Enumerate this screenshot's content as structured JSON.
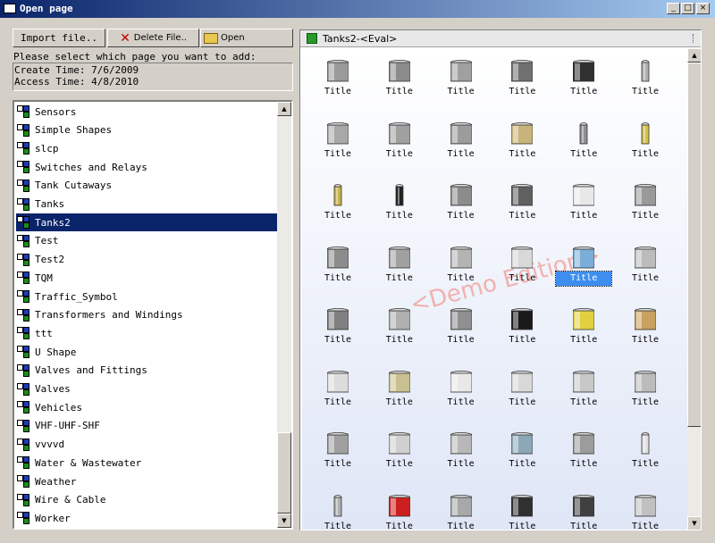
{
  "window": {
    "title": "Open page",
    "controls": [
      "_",
      "□",
      "×"
    ]
  },
  "toolbar": {
    "import_label": "Import file..",
    "delete_label": "Delete File..",
    "open_label": "Open"
  },
  "prompt": "Please select which page you want to add:",
  "info": {
    "create": "Create Time: 7/6/2009",
    "access": "Access Time: 4/8/2010"
  },
  "pages": [
    "Sensors",
    "Simple Shapes",
    "slcp",
    "Switches and Relays",
    "Tank Cutaways",
    "Tanks",
    "Tanks2",
    "Test",
    "Test2",
    "TQM",
    "Traffic_Symbol",
    "Transformers and Windings",
    "ttt",
    "U Shape",
    "Valves and Fittings",
    "Valves",
    "Vehicles",
    "VHF-UHF-SHF",
    "vvvvd",
    "Water & Wastewater",
    "Weather",
    "Wire & Cable",
    "Worker"
  ],
  "selected_page": "Tanks2",
  "preview": {
    "title": "Tanks2-<Eval>",
    "watermark": "<Demo Edition>",
    "selected_index": 22,
    "items": [
      {
        "label": "Title",
        "icon": "flat-top-tank-icon",
        "color": "#9a9a9a"
      },
      {
        "label": "Title",
        "icon": "storage-tank-icon",
        "color": "#8c8c8c"
      },
      {
        "label": "Title",
        "icon": "ribbed-tank-icon",
        "color": "#a0a0a0"
      },
      {
        "label": "Title",
        "icon": "horizontal-grid-tank-icon",
        "color": "#707070"
      },
      {
        "label": "Title",
        "icon": "louvered-box-icon",
        "color": "#303030"
      },
      {
        "label": "Title",
        "icon": "slim-column-icon",
        "color": "#b0b0b0"
      },
      {
        "label": "Title",
        "icon": "column-tank-icon",
        "color": "#a8a8a8"
      },
      {
        "label": "Title",
        "icon": "banded-column-icon",
        "color": "#a0a0a0"
      },
      {
        "label": "Title",
        "icon": "silo-bank-icon",
        "color": "#9c9c9c"
      },
      {
        "label": "Title",
        "icon": "brick-tower-icon",
        "color": "#c8b47a"
      },
      {
        "label": "Title",
        "icon": "piped-column-icon",
        "color": "#909090"
      },
      {
        "label": "Title",
        "icon": "yellow-gauge-column-icon",
        "color": "#d4c04a"
      },
      {
        "label": "Title",
        "icon": "gauge-column-icon",
        "color": "#c8b44a"
      },
      {
        "label": "Title",
        "icon": "black-column-icon",
        "color": "#202020"
      },
      {
        "label": "Title",
        "icon": "drum-icon",
        "color": "#8c8c8c"
      },
      {
        "label": "Title",
        "icon": "dark-drum-icon",
        "color": "#606060"
      },
      {
        "label": "Title",
        "icon": "bucket-icon",
        "color": "#e8e8e8"
      },
      {
        "label": "Title",
        "icon": "metal-drum-icon",
        "color": "#9a9a9a"
      },
      {
        "label": "Title",
        "icon": "cylinder-tank-icon",
        "color": "#8c8c8c"
      },
      {
        "label": "Title",
        "icon": "narrow-tank-icon",
        "color": "#a0a0a0"
      },
      {
        "label": "Title",
        "icon": "horizontal-tank-icon",
        "color": "#b4b4b4"
      },
      {
        "label": "Title",
        "icon": "light-tank-icon",
        "color": "#d8d8d8"
      },
      {
        "label": "Title",
        "icon": "hopper-icon",
        "color": "#7aaed8"
      },
      {
        "label": "Title",
        "icon": "half-drum-icon",
        "color": "#bcbcbc"
      },
      {
        "label": "Title",
        "icon": "cage-tank-icon",
        "color": "#808080"
      },
      {
        "label": "Title",
        "icon": "sphere-tank-icon",
        "color": "#b0b0b0"
      },
      {
        "label": "Title",
        "icon": "legged-sphere-icon",
        "color": "#909090"
      },
      {
        "label": "Title",
        "icon": "black-cylinder-icon",
        "color": "#1a1a1a"
      },
      {
        "label": "Title",
        "icon": "yellow-machine-icon",
        "color": "#e0d040"
      },
      {
        "label": "Title",
        "icon": "coil-icon",
        "color": "#c8a060"
      },
      {
        "label": "Title",
        "icon": "dome-tank-icon",
        "color": "#dcdcdc"
      },
      {
        "label": "Title",
        "icon": "olive-tank-icon",
        "color": "#c8c090"
      },
      {
        "label": "Title",
        "icon": "white-tank-icon",
        "color": "#e8e8e8"
      },
      {
        "label": "Title",
        "icon": "trough-icon",
        "color": "#d8d8d8"
      },
      {
        "label": "Title",
        "icon": "stand-tank-icon",
        "color": "#c8c8c8"
      },
      {
        "label": "Title",
        "icon": "water-tower-icon",
        "color": "#bcbcbc"
      },
      {
        "label": "Title",
        "icon": "funnel-hopper-icon",
        "color": "#a0a0a0"
      },
      {
        "label": "Title",
        "icon": "flat-box-tank-icon",
        "color": "#d0d0d0"
      },
      {
        "label": "Title",
        "icon": "skid-tank-icon",
        "color": "#b8b8b8"
      },
      {
        "label": "Title",
        "icon": "trailer-tank-icon",
        "color": "#8ca8b8"
      },
      {
        "label": "Title",
        "icon": "large-drum-icon",
        "color": "#9c9c9c"
      },
      {
        "label": "Title",
        "icon": "capsule-icon",
        "color": "#e0e0e0"
      },
      {
        "label": "Title",
        "icon": "gas-bottle-icon",
        "color": "#b0b0b0"
      },
      {
        "label": "Title",
        "icon": "red-cylinder-icon",
        "color": "#cc2020"
      },
      {
        "label": "Title",
        "icon": "panel-tank-icon",
        "color": "#a8a8a8"
      },
      {
        "label": "Title",
        "icon": "truss-icon",
        "color": "#303030"
      },
      {
        "label": "Title",
        "icon": "tower-frame-icon",
        "color": "#404040"
      },
      {
        "label": "Title",
        "icon": "pump-unit-icon",
        "color": "#c0c0c0"
      }
    ]
  }
}
